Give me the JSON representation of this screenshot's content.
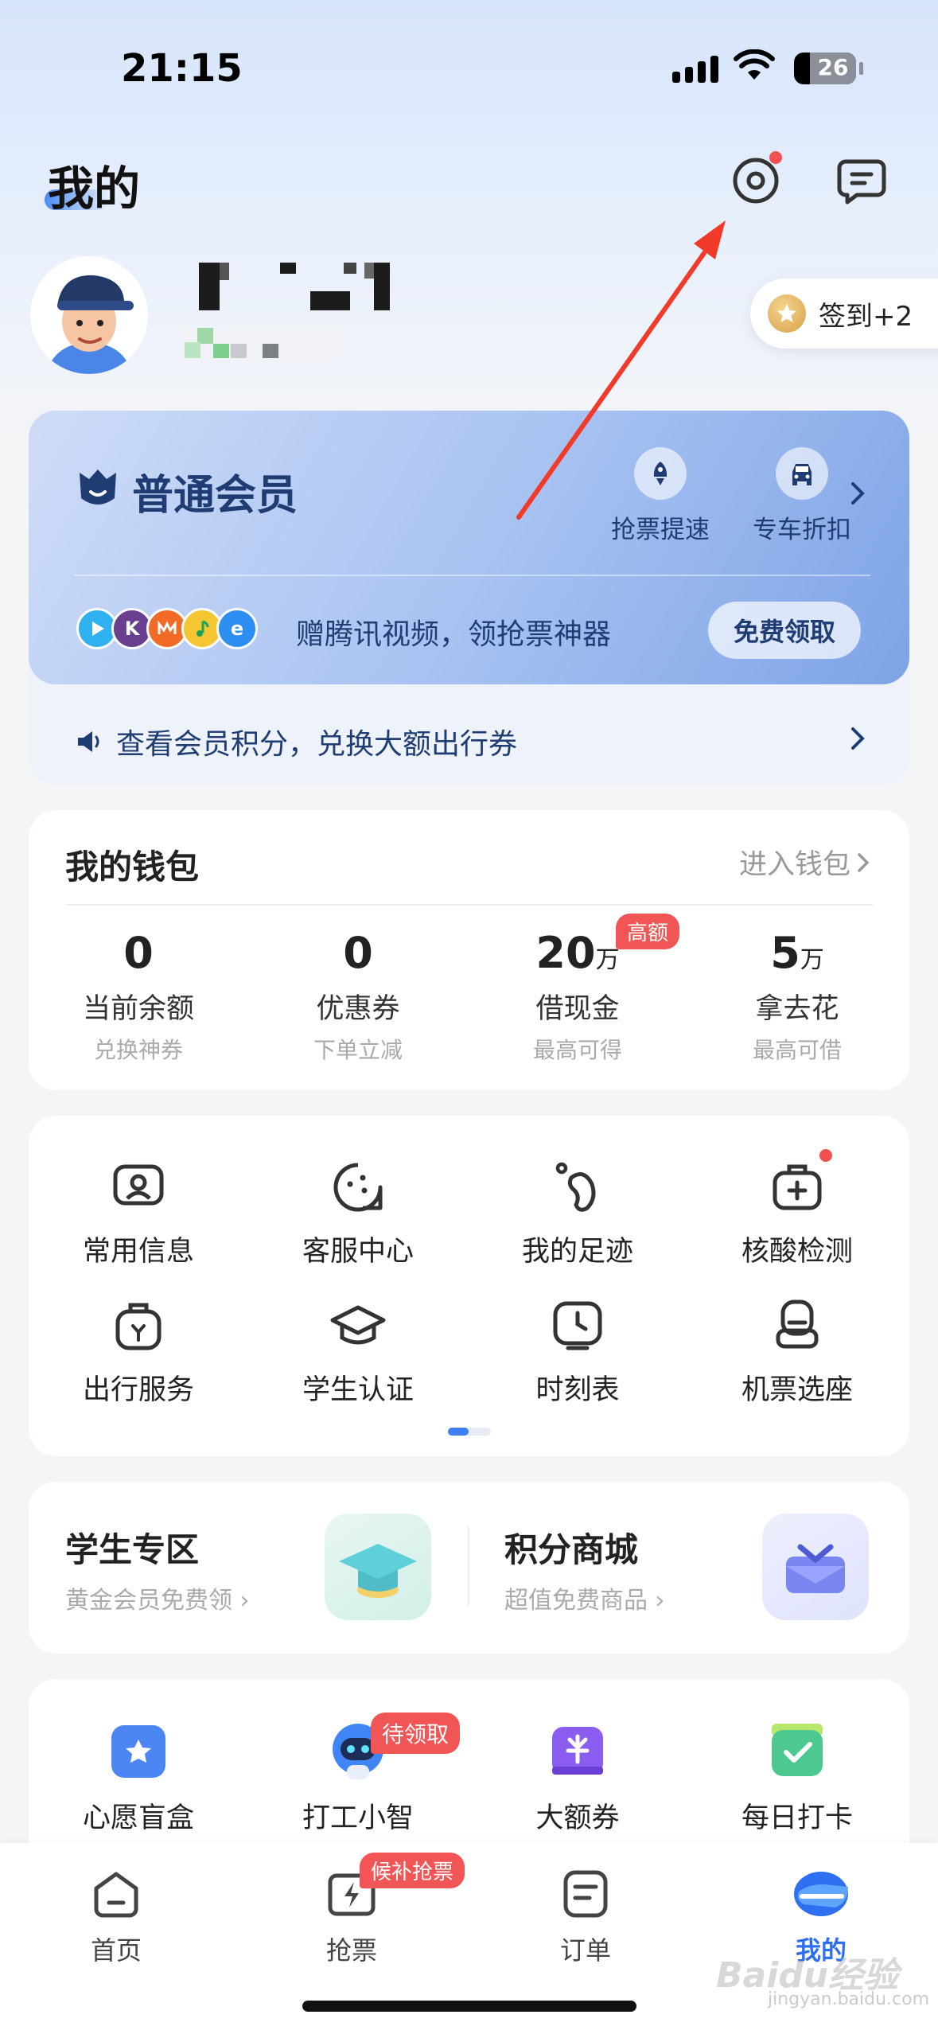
{
  "status_bar": {
    "time": "21:15",
    "battery": "26"
  },
  "header": {
    "title": "我的"
  },
  "profile": {
    "checkin_label": "签到+2"
  },
  "member": {
    "title": "普通会员",
    "perks": [
      {
        "label": "抢票提速",
        "icon": "rocket-icon"
      },
      {
        "label": "专车折扣",
        "icon": "car-icon"
      }
    ],
    "app_logos": [
      {
        "icon": "tencent-video-icon",
        "color": "#2fb1f1"
      },
      {
        "icon": "k-app-icon",
        "color": "#6a3f8f",
        "text": "K"
      },
      {
        "icon": "mango-tv-icon",
        "color": "#f26b26"
      },
      {
        "icon": "qq-music-icon",
        "color": "#f5c532"
      },
      {
        "icon": "e-app-icon",
        "color": "#2d8ef2",
        "text": "e"
      }
    ],
    "promo_text": "赠腾讯视频，领抢票神器",
    "promo_button": "免费领取",
    "points_text": "查看会员积分，兑换大额出行券"
  },
  "wallet": {
    "title": "我的钱包",
    "link": "进入钱包",
    "items": [
      {
        "value": "0",
        "unit": "",
        "label": "当前余额",
        "sub": "兑换神券"
      },
      {
        "value": "0",
        "unit": "",
        "label": "优惠券",
        "sub": "下单立减"
      },
      {
        "value": "20",
        "unit": "万",
        "label": "借现金",
        "sub": "最高可得",
        "tag": "高额"
      },
      {
        "value": "5",
        "unit": "万",
        "label": "拿去花",
        "sub": "最高可借"
      }
    ]
  },
  "services": [
    {
      "label": "常用信息",
      "icon": "id-card-icon"
    },
    {
      "label": "客服中心",
      "icon": "customer-service-icon"
    },
    {
      "label": "我的足迹",
      "icon": "footprint-icon"
    },
    {
      "label": "核酸检测",
      "icon": "medical-kit-icon",
      "dot": true
    },
    {
      "label": "出行服务",
      "icon": "luggage-icon"
    },
    {
      "label": "学生认证",
      "icon": "graduation-cap-icon"
    },
    {
      "label": "时刻表",
      "icon": "clock-icon"
    },
    {
      "label": "机票选座",
      "icon": "seat-icon"
    }
  ],
  "zones": [
    {
      "title": "学生专区",
      "sub": "黄金会员免费领",
      "icon": "graduation-cap-3d-icon"
    },
    {
      "title": "积分商城",
      "sub": "超值免费商品",
      "icon": "gift-box-3d-icon"
    }
  ],
  "tools": [
    {
      "label": "心愿盲盒",
      "icon": "wish-box-icon"
    },
    {
      "label": "打工小智",
      "icon": "robot-icon",
      "tag": "待领取"
    },
    {
      "label": "大额券",
      "icon": "coupon-icon"
    },
    {
      "label": "每日打卡",
      "icon": "checkin-calendar-icon"
    }
  ],
  "tabbar": {
    "tabs": [
      {
        "label": "首页",
        "icon": "home-icon"
      },
      {
        "label": "抢票",
        "icon": "lightning-icon",
        "tag": "候补抢票"
      },
      {
        "label": "订单",
        "icon": "order-icon"
      },
      {
        "label": "我的",
        "icon": "profile-icon",
        "active": true
      }
    ]
  },
  "watermark": {
    "text": "Baidu经验",
    "sub": "jingyan.baidu.com"
  },
  "colors": {
    "accent": "#2d6ff0",
    "red": "#f25555",
    "member_text": "#1f3c73",
    "annotation_arrow": "#f23a2a"
  }
}
